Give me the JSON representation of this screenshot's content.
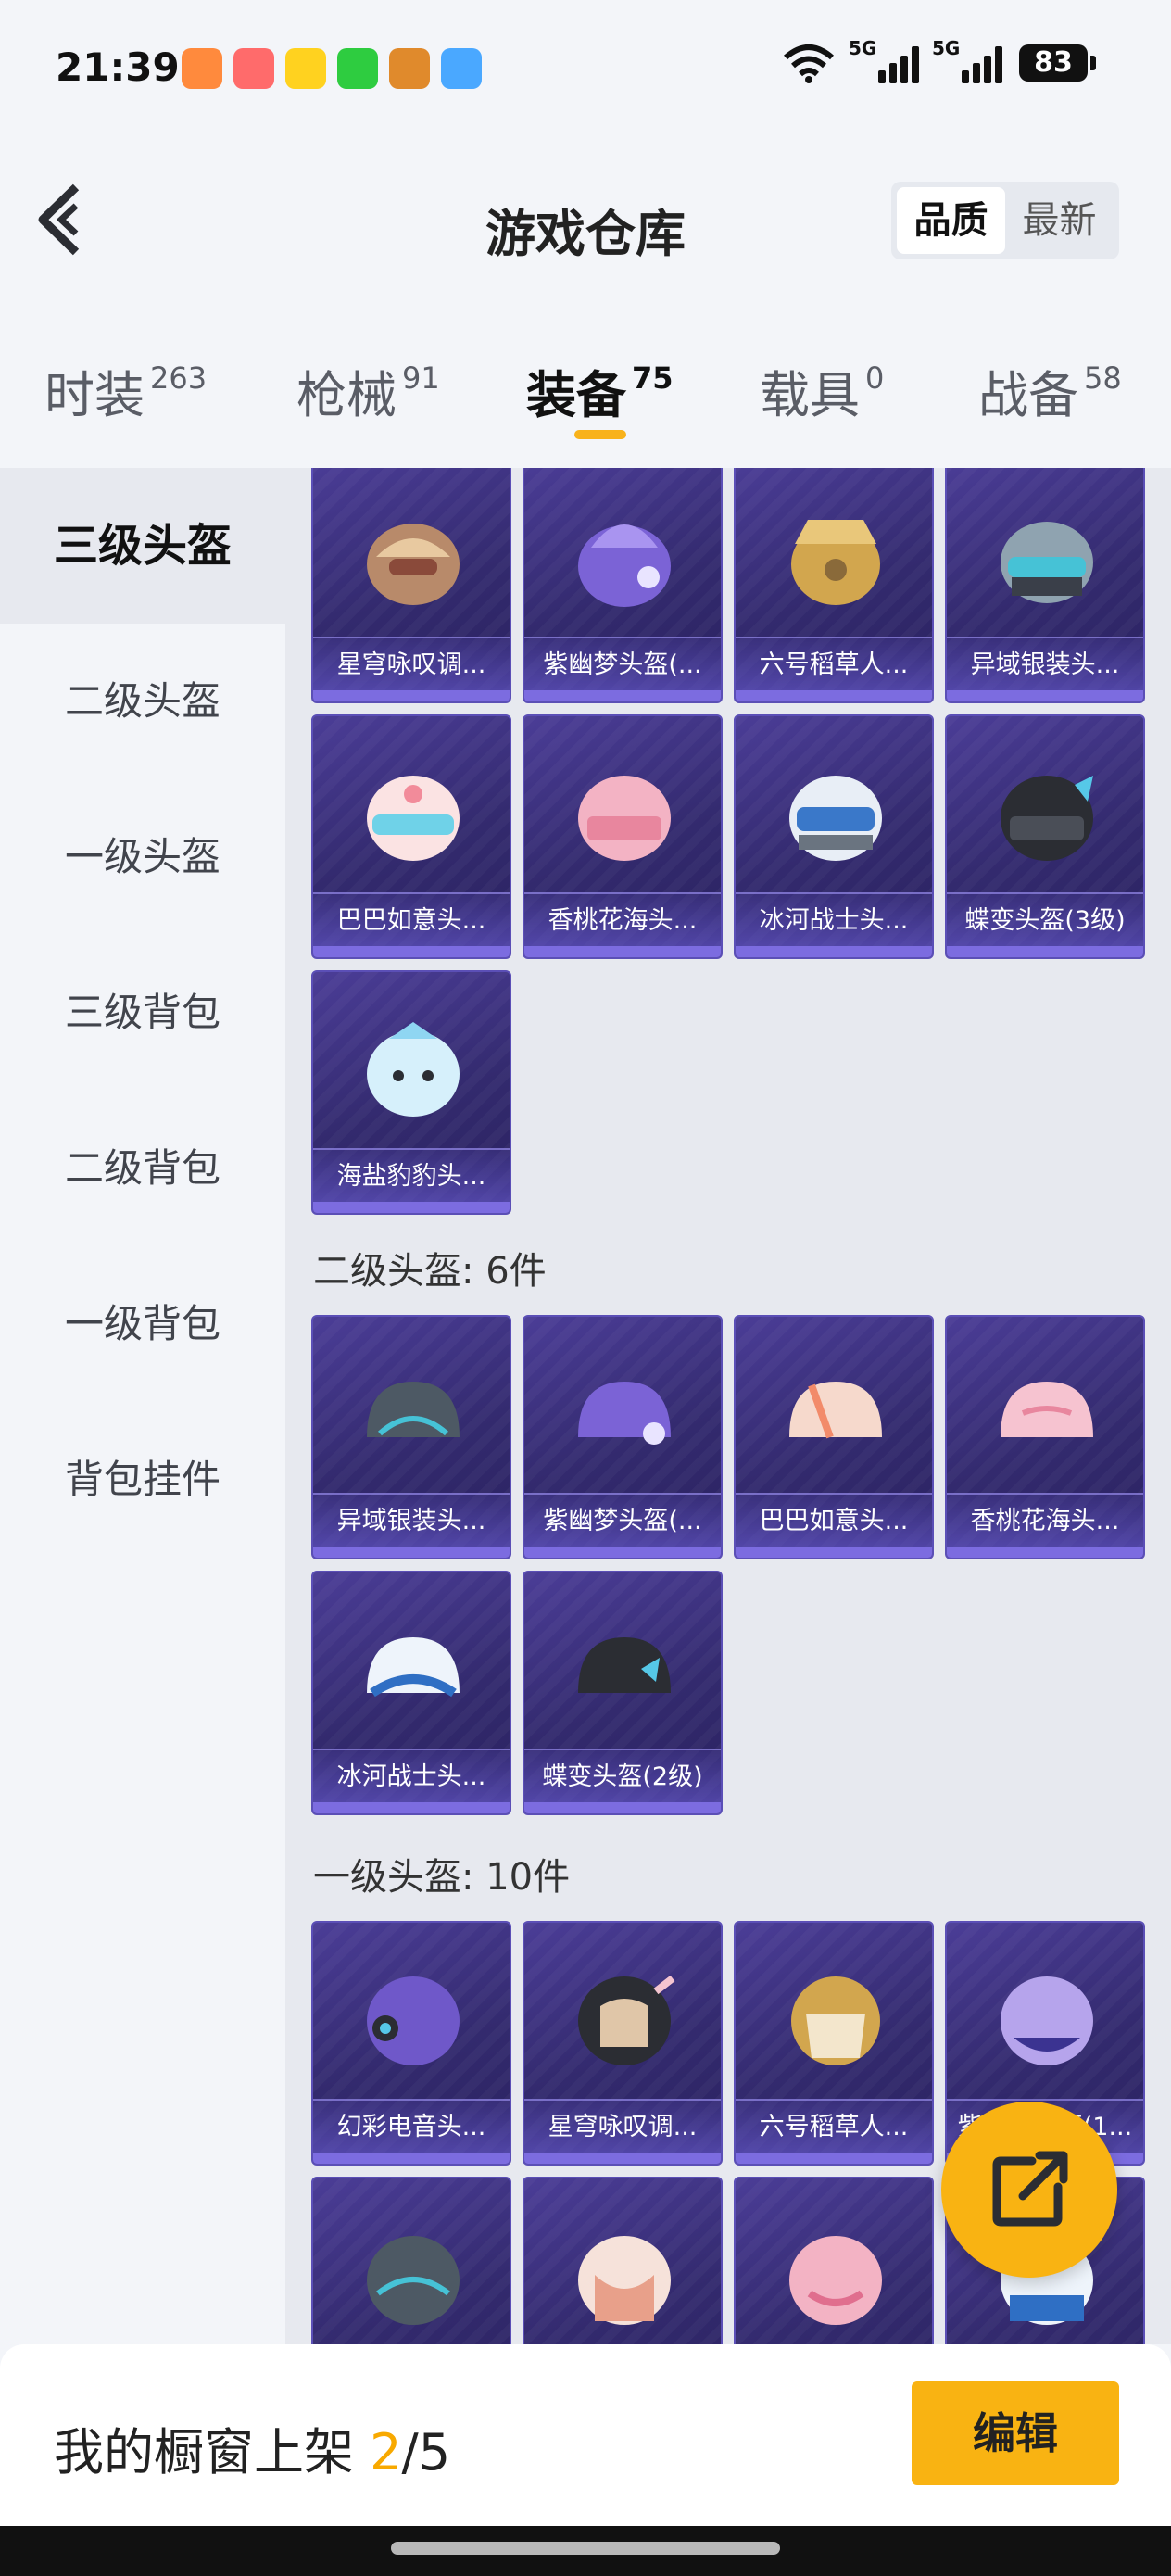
{
  "status": {
    "time": "21:39",
    "network1": "5G",
    "network2": "5G",
    "battery": "83"
  },
  "header": {
    "title": "游戏仓库",
    "sort_quality": "品质",
    "sort_latest": "最新"
  },
  "tabs": [
    {
      "label": "时装",
      "count": "263"
    },
    {
      "label": "枪械",
      "count": "91"
    },
    {
      "label": "装备",
      "count": "75"
    },
    {
      "label": "载具",
      "count": "0"
    },
    {
      "label": "战备",
      "count": "58"
    }
  ],
  "sidebar": {
    "items": [
      "三级头盔",
      "二级头盔",
      "一级头盔",
      "三级背包",
      "二级背包",
      "一级背包",
      "背包挂件"
    ]
  },
  "sections": {
    "level3_items": [
      "星穹咏叹调...",
      "紫幽梦头盔(...",
      "六号稻草人...",
      "异域银装头...",
      "巴巴如意头...",
      "香桃花海头...",
      "冰河战士头...",
      "蝶变头盔(3级)",
      "海盐豹豹头..."
    ],
    "level2_title": "二级头盔: 6件",
    "level2_items": [
      "异域银装头...",
      "紫幽梦头盔(...",
      "巴巴如意头...",
      "香桃花海头...",
      "冰河战士头...",
      "蝶变头盔(2级)"
    ],
    "level1_title": "一级头盔: 10件",
    "level1_items": [
      "幻彩电音头...",
      "星穹咏叹调...",
      "六号稻草人...",
      "紫幽梦头盔(1..."
    ]
  },
  "bottom": {
    "showcase_prefix": "我的橱窗上架 ",
    "showcase_count": "2",
    "showcase_total": "/5",
    "edit_label": "编辑"
  },
  "colors": {
    "accent": "#f9b312",
    "card_bg": "#3b3180"
  }
}
